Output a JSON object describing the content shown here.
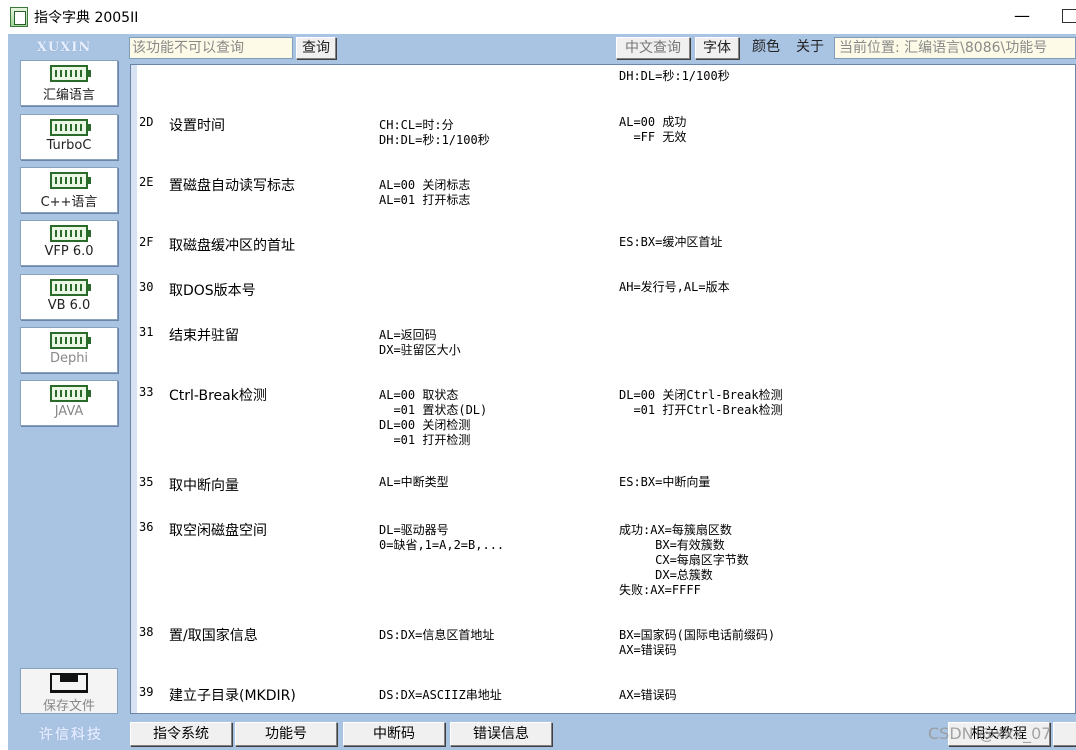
{
  "window": {
    "title": "指令字典 2005II",
    "minimize": "—"
  },
  "toolbar": {
    "logo_top": "XUXIN",
    "search_value": "该功能不可以查询",
    "query_button": "查询",
    "cn_query_button": "中文查询",
    "font_button": "字体",
    "color_button": "颜色",
    "about_button": "关于",
    "location": "当前位置: 汇编语言\\8086\\功能号"
  },
  "sidebar": {
    "items": [
      {
        "label": "汇编语言",
        "enabled": true
      },
      {
        "label": "TurboC",
        "enabled": true
      },
      {
        "label": "C++语言",
        "enabled": true
      },
      {
        "label": "VFP 6.0",
        "enabled": true
      },
      {
        "label": "VB 6.0",
        "enabled": true
      },
      {
        "label": "Dephi",
        "enabled": false
      },
      {
        "label": "JAVA",
        "enabled": false
      }
    ],
    "save_label": "保存文件",
    "logo_bottom": "许信科技"
  },
  "content": {
    "top_out": "DH:DL=秒:1/100秒",
    "rows": [
      {
        "code": "2D",
        "name": "设置时间",
        "input": "CH:CL=时:分\nDH:DL=秒:1/100秒",
        "output": "AL=00 成功\n  =FF 无效"
      },
      {
        "code": "2E",
        "name": "置磁盘自动读写标志",
        "input": "AL=00 关闭标志\nAL=01 打开标志",
        "output": ""
      },
      {
        "code": "2F",
        "name": "取磁盘缓冲区的首址",
        "input": "",
        "output": "ES:BX=缓冲区首址"
      },
      {
        "code": "30",
        "name": "取DOS版本号",
        "input": "",
        "output": "AH=发行号,AL=版本"
      },
      {
        "code": "31",
        "name": "结束并驻留",
        "input": "AL=返回码\nDX=驻留区大小",
        "output": ""
      },
      {
        "code": "33",
        "name": "Ctrl-Break检测",
        "input": "AL=00 取状态\n  =01 置状态(DL)\nDL=00 关闭检测\n  =01 打开检测",
        "output": "DL=00 关闭Ctrl-Break检测\n  =01 打开Ctrl-Break检测"
      },
      {
        "code": "35",
        "name": "取中断向量",
        "input": "AL=中断类型",
        "output": "ES:BX=中断向量"
      },
      {
        "code": "36",
        "name": "取空闲磁盘空间",
        "input": "DL=驱动器号\n0=缺省,1=A,2=B,...",
        "output": "成功:AX=每簇扇区数\n     BX=有效簇数\n     CX=每扇区字节数\n     DX=总簇数\n失败:AX=FFFF"
      },
      {
        "code": "38",
        "name": "置/取国家信息",
        "input": "DS:DX=信息区首地址",
        "output": "BX=国家码(国际电话前缀码)\nAX=错误码"
      },
      {
        "code": "39",
        "name": "建立子目录(MKDIR)",
        "input": "DS:DX=ASCIIZ串地址",
        "output": "AX=错误码"
      }
    ]
  },
  "bottom": {
    "tabs": [
      "指令系统",
      "功能号",
      "中断码",
      "错误信息"
    ],
    "related": "相关教程",
    "watermark": "CSDN @xxx_07"
  }
}
